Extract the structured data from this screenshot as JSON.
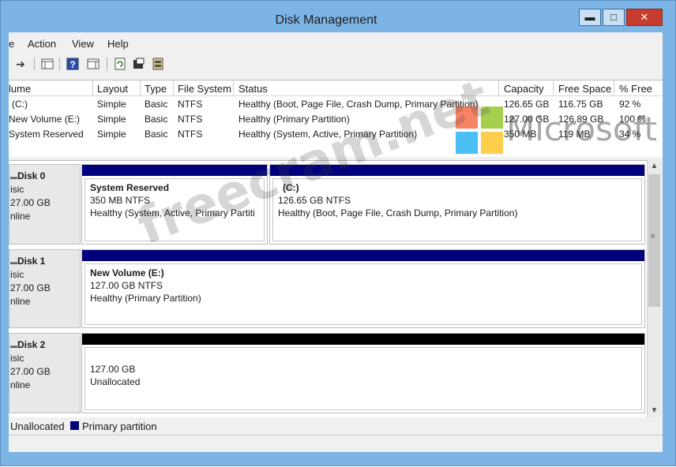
{
  "window": {
    "title": "Disk Management",
    "controls": {
      "minimize": "▬",
      "maximize": "□",
      "close": "✕"
    }
  },
  "menu": [
    {
      "label": "e"
    },
    {
      "label": "Action"
    },
    {
      "label": "View"
    },
    {
      "label": "Help"
    }
  ],
  "toolbar": [
    {
      "icon": "forward-arrow-icon"
    },
    {
      "icon": "console-tree-icon"
    },
    {
      "icon": "help-icon"
    },
    {
      "icon": "action-pane-icon"
    },
    {
      "icon": "refresh-icon"
    },
    {
      "icon": "properties-icon"
    },
    {
      "icon": "rescan-disks-icon"
    }
  ],
  "volumes": {
    "columns": [
      "lume",
      "Layout",
      "Type",
      "File System",
      "Status",
      "Capacity",
      "Free Space",
      "% Free"
    ],
    "rows": [
      [
        "(C:)",
        "Simple",
        "Basic",
        "NTFS",
        "Healthy (Boot, Page File, Crash Dump, Primary Partition)",
        "126.65 GB",
        "116.75 GB",
        "92 %"
      ],
      [
        "New Volume (E:)",
        "Simple",
        "Basic",
        "NTFS",
        "Healthy (Primary Partition)",
        "127.00 GB",
        "126.89 GB",
        "100 %"
      ],
      [
        "System Reserved",
        "Simple",
        "Basic",
        "NTFS",
        "Healthy (System, Active, Primary Partition)",
        "350 MB",
        "119 MB",
        "34 %"
      ]
    ]
  },
  "disks": [
    {
      "label": {
        "name": "Disk 0",
        "type": "isic",
        "size": "27.00 GB",
        "state": "nline"
      },
      "partitions": [
        {
          "name": "System Reserved",
          "size": "350 MB NTFS",
          "status": "Healthy (System, Active, Primary Partiti",
          "kind": "primary"
        },
        {
          "name": "(C:)",
          "size": "126.65 GB NTFS",
          "status": "Healthy (Boot, Page File, Crash Dump, Primary Partition)",
          "kind": "primary"
        }
      ]
    },
    {
      "label": {
        "name": "Disk 1",
        "type": "isic",
        "size": "27.00 GB",
        "state": "nline"
      },
      "partitions": [
        {
          "name": "New Volume (E:)",
          "size": "127.00 GB NTFS",
          "status": "Healthy (Primary Partition)",
          "kind": "primary"
        }
      ]
    },
    {
      "label": {
        "name": "Disk 2",
        "type": "isic",
        "size": "27.00 GB",
        "state": "nline"
      },
      "partitions": [
        {
          "name": "",
          "size": "127.00 GB",
          "status": "Unallocated",
          "kind": "unallocated"
        }
      ]
    }
  ],
  "legend": [
    {
      "label": "Unallocated",
      "color": "#000000"
    },
    {
      "label": "Primary partition",
      "color": "#00007e"
    }
  ],
  "colors": {
    "primary_bar": "#00007e",
    "unallocated_bar": "#000000",
    "title_bar": "#7db4e6"
  },
  "watermark": {
    "site": "freecram.net",
    "brand": "Microsoft"
  }
}
